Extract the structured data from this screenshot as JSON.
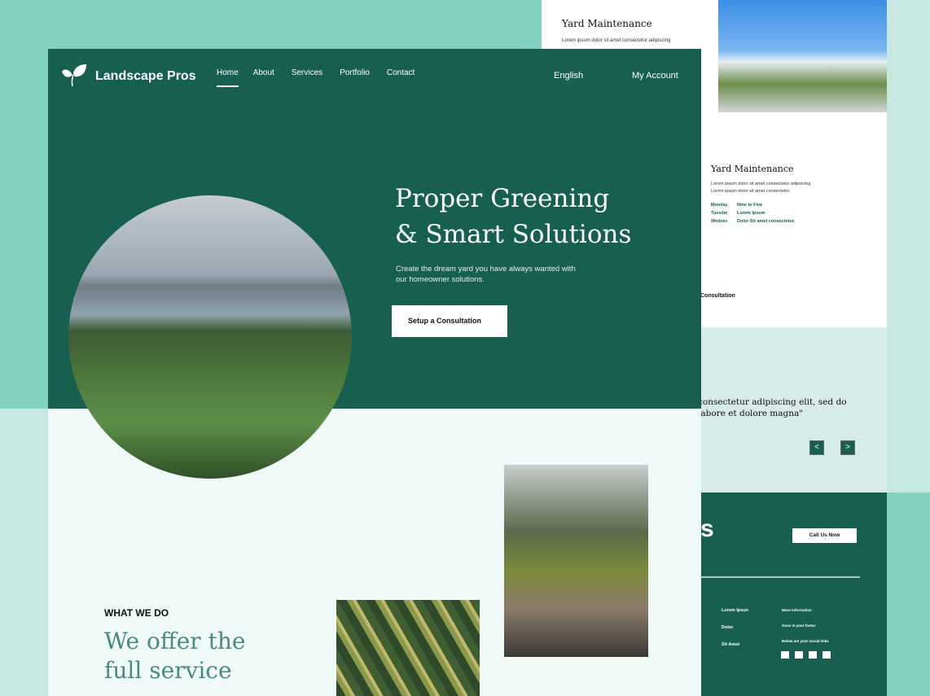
{
  "colors": {
    "primary": "#17604f",
    "accent_bg": "#82d2c2",
    "pale_bg": "#c7e8e0",
    "light_section": "#eef9f8",
    "testimonial_bg": "#d7ebe8"
  },
  "back_page": {
    "card1": {
      "title": "Yard Maintenance",
      "text": "Lorem ipsum dolor sit amet consectetur adipiscing"
    },
    "card2": {
      "title": "Yard Maintenance",
      "text": "Lorem ipsum dolor sit amet consectetur adipiscing. Lorem ipsum dolor sit amet consectetur.",
      "schedule": [
        {
          "day": "Monday",
          "value": "Nine to Five"
        },
        {
          "day": "Tuesday",
          "value": "Lorem Ipsum"
        },
        {
          "day": "Wednesday",
          "value": "Dolor Sit amet consectetur."
        }
      ]
    },
    "consultation_fragment": "Consultation",
    "testimonial": {
      "line1": "consectetur adipiscing elit, sed do",
      "line2": "labore et dolore magna\"",
      "prev": "<",
      "next": ">"
    },
    "footer": {
      "heading_fragment": "s",
      "call_button": "Call Us Now",
      "links": [
        "Lorem Ipsun",
        "Dolor",
        "Sit Amet"
      ],
      "info": [
        "More information",
        "Goes in your footer",
        "Below are your social links"
      ]
    }
  },
  "header": {
    "brand": "Landscape Pros",
    "nav": [
      "Home",
      "About",
      "Services",
      "Portfolio",
      "Contact"
    ],
    "active": "Home",
    "language": "English",
    "account": "My Account"
  },
  "hero": {
    "title_line1": "Proper Greening",
    "title_line2": "& Smart Solutions",
    "subtitle_line1": "Create the dream yard you have always wanted with",
    "subtitle_line2": "our homeowner solutions.",
    "cta": "Setup a Consultation"
  },
  "services": {
    "eyebrow": "WHAT WE DO",
    "heading_line1": "We offer the",
    "heading_line2": "full service"
  }
}
